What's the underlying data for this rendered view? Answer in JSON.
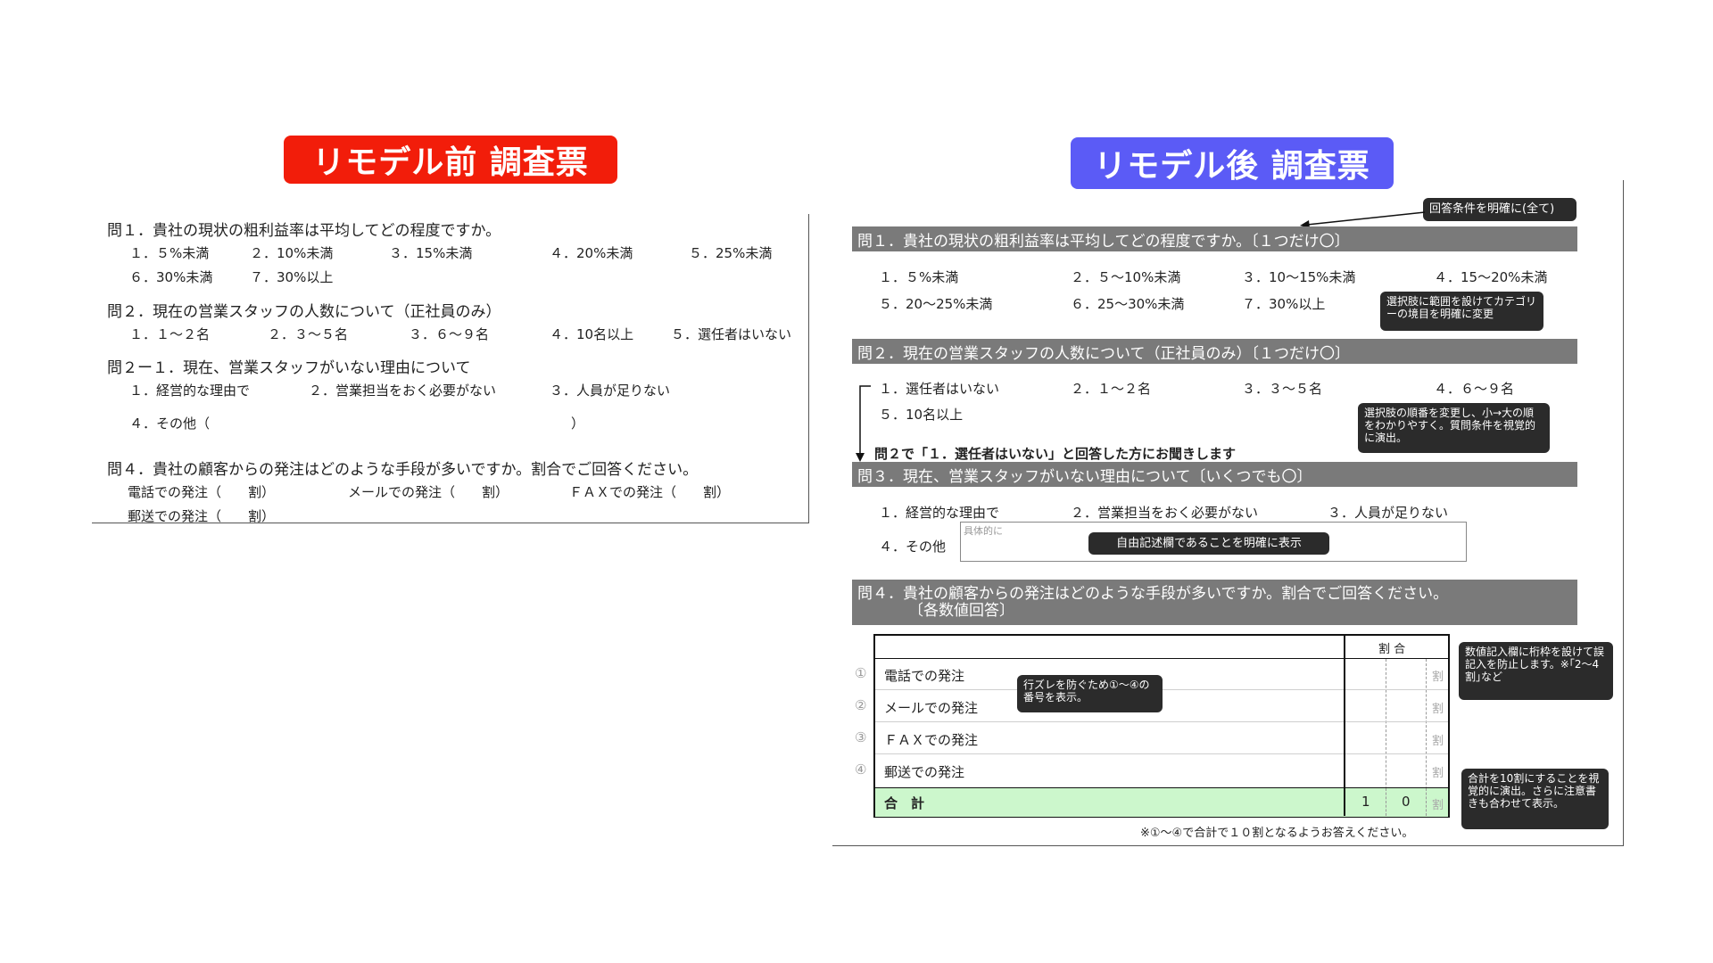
{
  "before": {
    "badge": "リモデル前 調査票",
    "q1": {
      "title": "問１．貴社の現状の粗利益率は平均してどの程度ですか。",
      "options": [
        "１．５%未満",
        "２．10%未満",
        "３．15%未満",
        "４．20%未満",
        "５．25%未満",
        "６．30%未満",
        "７．30%以上"
      ]
    },
    "q2": {
      "title": "問２．現在の営業スタッフの人数について（正社員のみ）",
      "options": [
        "１．１～２名",
        "２．３～５名",
        "３．６～９名",
        "４．10名以上",
        "５．選任者はいない"
      ]
    },
    "q21": {
      "title": "問２ー１．現在、営業スタッフがいない理由について",
      "options": [
        "１．経営的な理由で",
        "２．営業担当をおく必要がない",
        "３．人員が足りない"
      ],
      "other_label": "４．その他（",
      "other_close": "）"
    },
    "q4": {
      "title": "問４．貴社の顧客からの発注はどのような手段が多いですか。割合でご回答ください。",
      "items": [
        "電話での発注（　　割）",
        "メールでの発注（　　割）",
        "ＦＡＸでの発注（　　割）",
        "郵送での発注（　　割）"
      ]
    }
  },
  "after": {
    "badge": "リモデル後 調査票",
    "note_top": "回答条件を明確に(全て)",
    "q1": {
      "title": "問１．貴社の現状の粗利益率は平均してどの程度ですか。〔１つだけ〇〕",
      "options": [
        "１．５%未満",
        "２．５～10%未満",
        "３．10～15%未満",
        "４．15～20%未満",
        "５．20～25%未満",
        "６．25～30%未満",
        "７．30%以上"
      ],
      "note": "選択肢に範囲を設けてカテゴリーの境目を明確に変更"
    },
    "q2": {
      "title": "問２．現在の営業スタッフの人数について（正社員のみ）〔１つだけ〇〕",
      "options": [
        "１．選任者はいない",
        "２．１～２名",
        "３．３～５名",
        "４．６～９名",
        "５．10名以上"
      ],
      "note": "選択肢の順番を変更し、小→大の順をわかりやすく。質問条件を視覚的に演出。",
      "branch": "問２で「１．選任者はいない」と回答した方にお聞きします"
    },
    "q3": {
      "title": "問３．現在、営業スタッフがいない理由について〔いくつでも〇〕",
      "options": [
        "１．経営的な理由で",
        "２．営業担当をおく必要がない",
        "３．人員が足りない"
      ],
      "other_label": "４．その他",
      "other_hint": "具体的に",
      "note": "自由記述欄であることを明確に表示"
    },
    "q4": {
      "title_line1": "問４．貴社の顧客からの発注はどのような手段が多いですか。割合でご回答ください。",
      "title_line2": "〔各数値回答〕",
      "header": "割 合",
      "rows": [
        {
          "num": "①",
          "label": "電話での発注"
        },
        {
          "num": "②",
          "label": "メールでの発注"
        },
        {
          "num": "③",
          "label": "ＦＡＸでの発注"
        },
        {
          "num": "④",
          "label": "郵送での発注"
        }
      ],
      "total_label": "合　計",
      "total_d1": "1",
      "total_d2": "0",
      "unit": "割",
      "footnote": "※①～④で合計で１０割となるようお答えください。",
      "note_rows": "行ズレを防ぐため①～④の番号を表示。",
      "note_digits": "数値記入欄に桁枠を設けて誤記入を防止します。※｢2～4割｣など",
      "note_total": "合計を10割にすることを視覚的に演出。さらに注意書きも合わせて表示。"
    },
    "colors": {
      "before_badge": "#f21d0a",
      "after_badge": "#5b5bf6",
      "bar": "#7a7a7a",
      "total_row": "#ccf7cc"
    }
  }
}
